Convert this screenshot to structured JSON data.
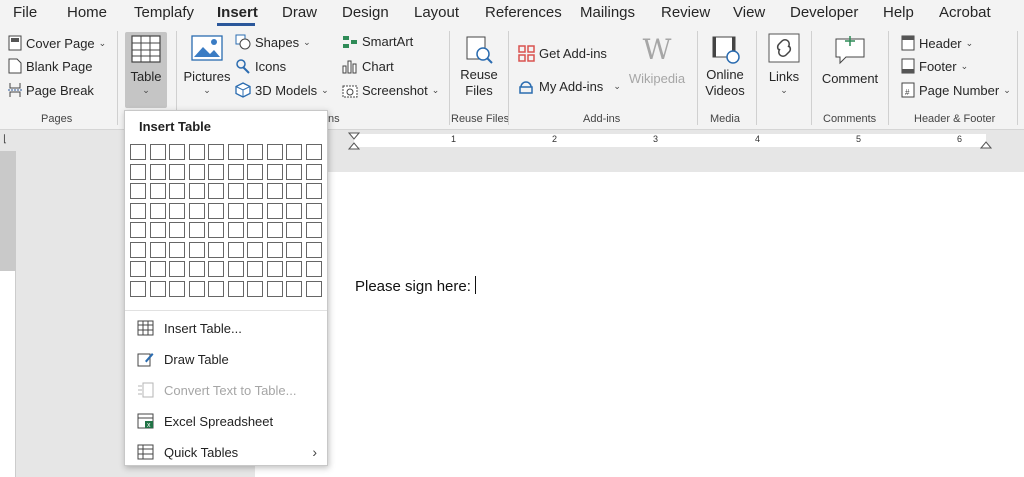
{
  "menu": {
    "tabs": [
      {
        "label": "File"
      },
      {
        "label": "Home"
      },
      {
        "label": "Templafy"
      },
      {
        "label": "Insert"
      },
      {
        "label": "Draw"
      },
      {
        "label": "Design"
      },
      {
        "label": "Layout"
      },
      {
        "label": "References"
      },
      {
        "label": "Mailings"
      },
      {
        "label": "Review"
      },
      {
        "label": "View"
      },
      {
        "label": "Developer"
      },
      {
        "label": "Help"
      },
      {
        "label": "Acrobat"
      }
    ],
    "active": "Insert",
    "accent": "#2b579a"
  },
  "ribbon": {
    "pages": {
      "cover_page": "Cover Page",
      "blank_page": "Blank Page",
      "page_break": "Page Break",
      "group": "Pages"
    },
    "tables": {
      "table": "Table"
    },
    "illustrations": {
      "pictures": "Pictures",
      "shapes": "Shapes",
      "icons": "Icons",
      "models": "3D Models",
      "smartart": "SmartArt",
      "chart": "Chart",
      "screenshot": "Screenshot",
      "group_tail": "ns"
    },
    "reuse": {
      "label_1": "Reuse",
      "label_2": "Files",
      "group": "Reuse Files"
    },
    "addins": {
      "get": "Get Add-ins",
      "my": "My Add-ins",
      "wikipedia": "Wikipedia",
      "group": "Add-ins"
    },
    "media": {
      "label_1": "Online",
      "label_2": "Videos",
      "group": "Media"
    },
    "links": {
      "label": "Links"
    },
    "comments": {
      "label": "Comment",
      "group": "Comments"
    },
    "header_footer": {
      "header": "Header",
      "footer": "Footer",
      "page_number": "Page Number",
      "group": "Header & Footer"
    }
  },
  "ruler": {
    "numbers": [
      "1",
      "2",
      "3",
      "4",
      "5",
      "6"
    ]
  },
  "document": {
    "text": "Please sign here:"
  },
  "dropdown": {
    "title": "Insert Table",
    "grid": {
      "cols": 10,
      "rows": 8
    },
    "items": {
      "insert_table": "Insert Table...",
      "draw_table": "Draw Table",
      "convert_text": "Convert Text to Table...",
      "excel": "Excel Spreadsheet",
      "quick_tables": "Quick Tables"
    }
  }
}
